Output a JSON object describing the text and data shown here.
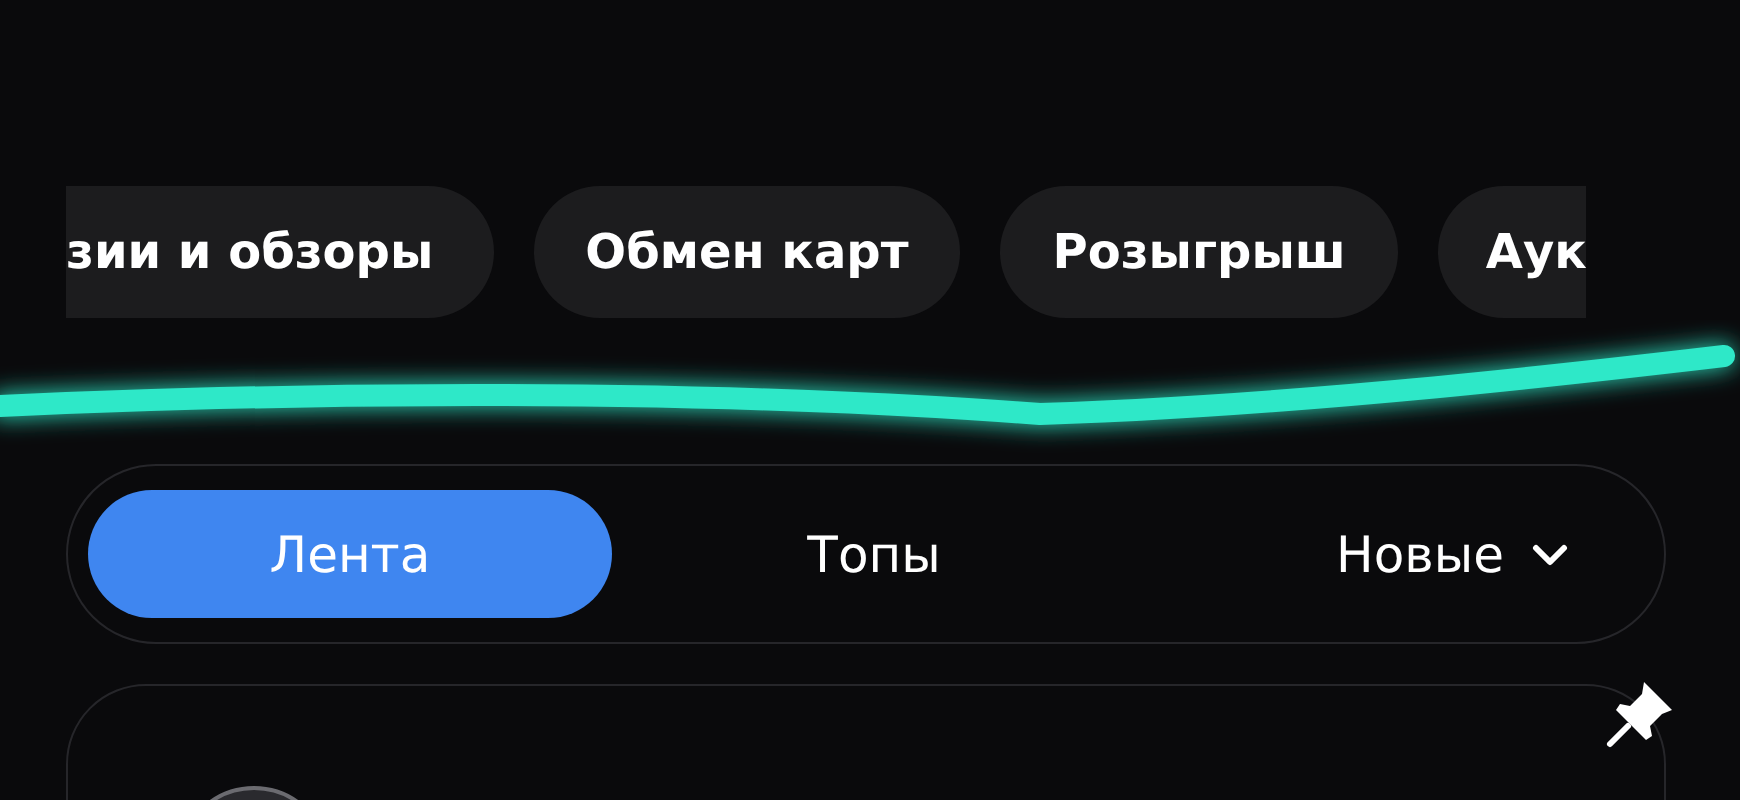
{
  "categories": [
    {
      "label": "зии и обзоры"
    },
    {
      "label": "Обмен карт"
    },
    {
      "label": "Розыгрыш"
    },
    {
      "label": "Аук"
    }
  ],
  "tabs": [
    {
      "label": "Лента",
      "selected": true
    },
    {
      "label": "Топы",
      "selected": false
    }
  ],
  "sort": {
    "label": "Новые"
  },
  "post": {
    "pinned": true
  }
}
